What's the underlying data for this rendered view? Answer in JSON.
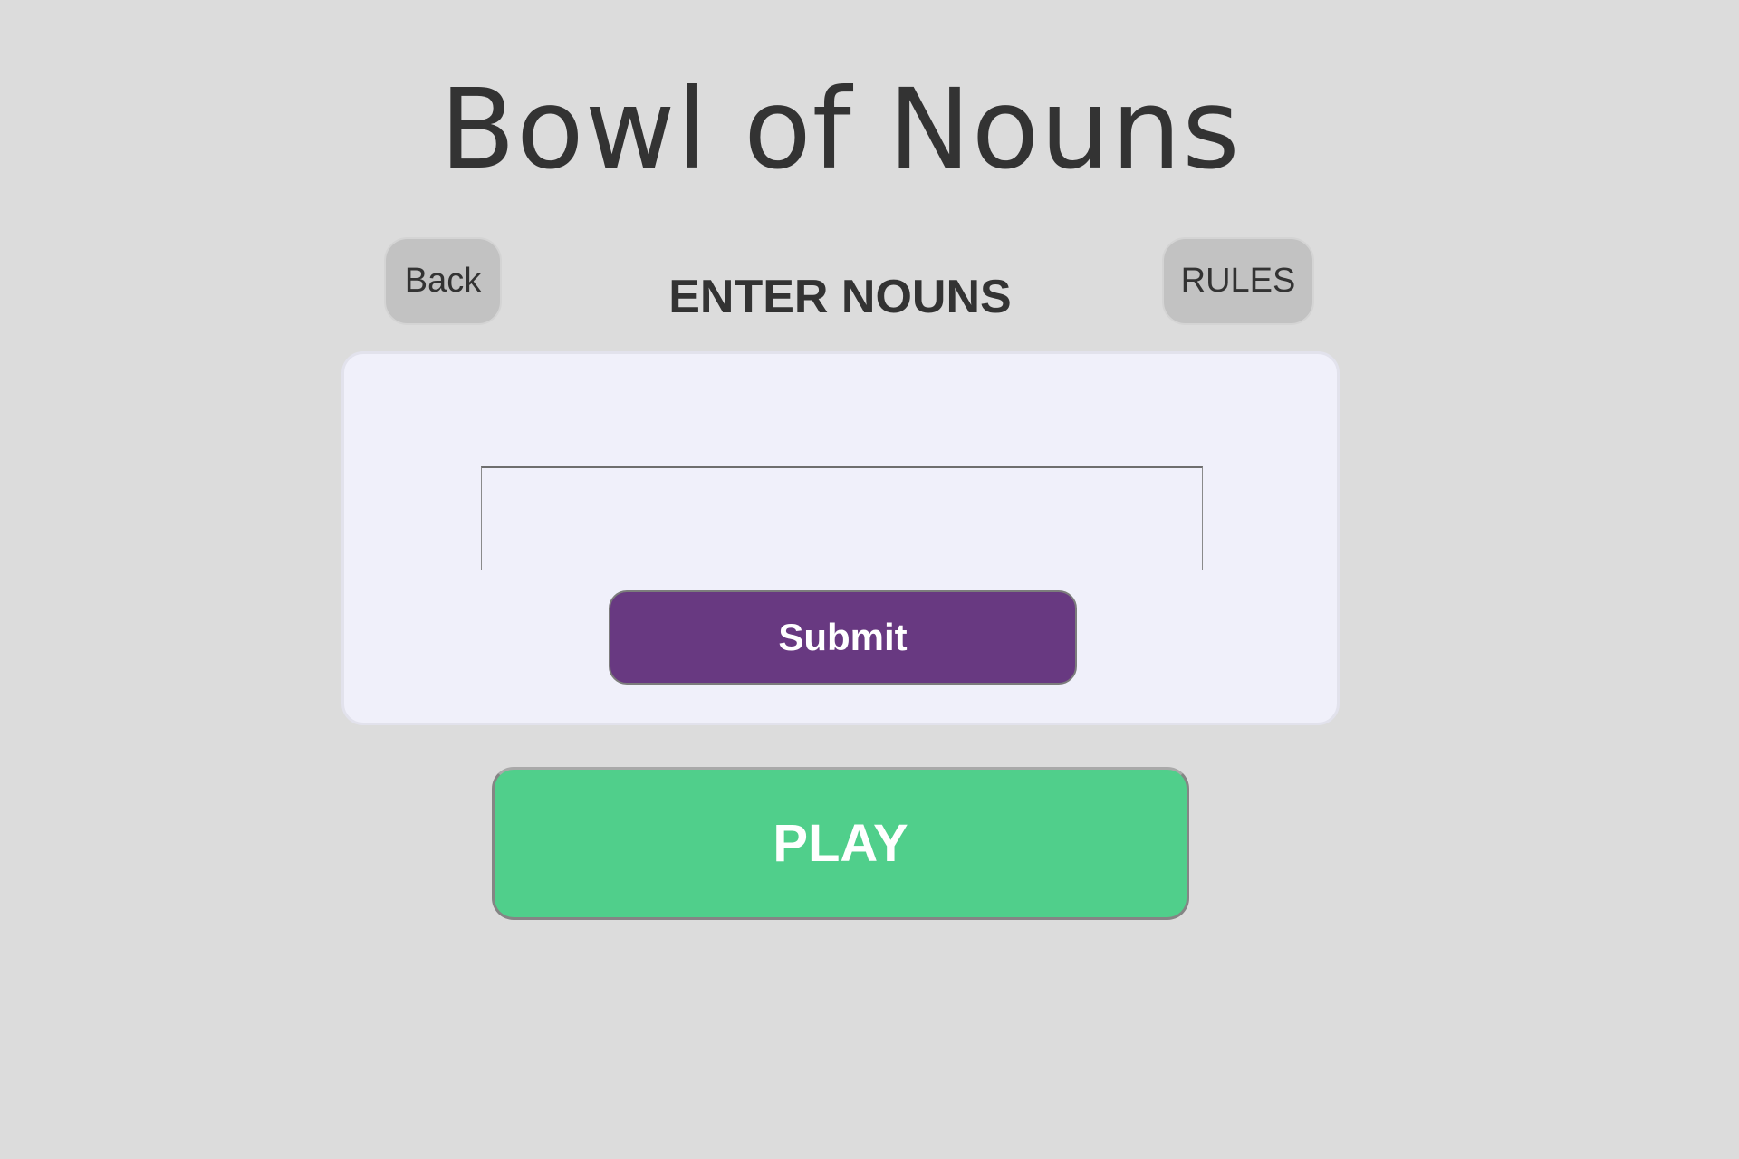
{
  "header": {
    "title": "Bowl of Nouns"
  },
  "nav": {
    "back_label": "Back",
    "rules_label": "RULES"
  },
  "section": {
    "heading": "ENTER NOUNS"
  },
  "form": {
    "noun_value": "",
    "noun_placeholder": "",
    "submit_label": "Submit"
  },
  "actions": {
    "play_label": "PLAY"
  },
  "colors": {
    "background": "#dcdcdc",
    "card_background": "#f0f0fa",
    "submit_purple": "#683981",
    "play_green": "#50cf8b",
    "secondary_button_gray": "#c2c2c2",
    "text_dark": "#333333"
  }
}
